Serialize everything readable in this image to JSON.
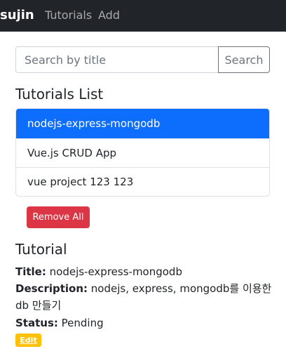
{
  "navbar": {
    "brand": "sujin",
    "links": [
      "Tutorials",
      "Add"
    ]
  },
  "search": {
    "placeholder": "Search by title",
    "value": "",
    "button_label": "Search"
  },
  "list": {
    "title": "Tutorials List",
    "items": [
      {
        "label": "nodejs-express-mongodb",
        "selected": true
      },
      {
        "label": "Vue.js CRUD App",
        "selected": false
      },
      {
        "label": "vue project 123 123",
        "selected": false
      }
    ],
    "remove_all_label": "Remove All"
  },
  "detail": {
    "heading": "Tutorial",
    "title_label": "Title:",
    "title_value": "nodejs-express-mongodb",
    "description_label": "Description:",
    "description_value": "nodejs, express, mongodb를 이용한 db 만들기",
    "status_label": "Status:",
    "status_value": "Pending",
    "edit_label": "Edit"
  },
  "colors": {
    "navbar_bg": "#212529",
    "active_item": "#0d6efd",
    "danger": "#dc3545",
    "warning": "#ffc107"
  }
}
